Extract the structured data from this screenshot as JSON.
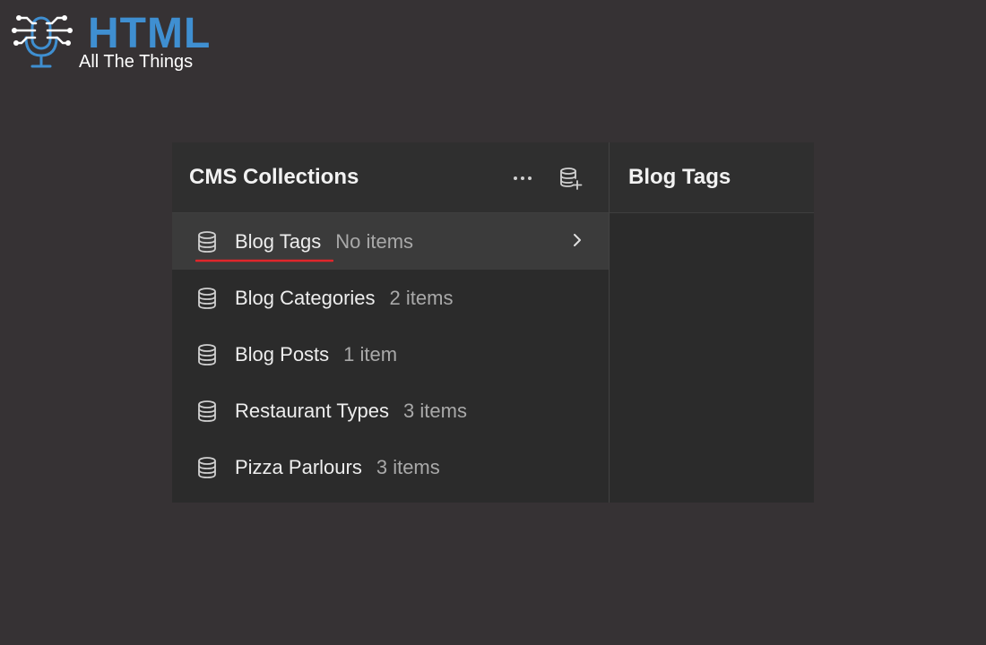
{
  "logo": {
    "brand": "HTML",
    "tagline": "All The Things",
    "brand_color": "#3f8fd1"
  },
  "left_panel": {
    "title": "CMS Collections",
    "more_icon": "more-horizontal-icon",
    "add_icon": "database-add-icon"
  },
  "right_panel": {
    "title": "Blog Tags"
  },
  "collections": [
    {
      "name": "Blog Tags",
      "count": "No items",
      "active": true
    },
    {
      "name": "Blog Categories",
      "count": "2 items",
      "active": false
    },
    {
      "name": "Blog Posts",
      "count": "1 item",
      "active": false
    },
    {
      "name": "Restaurant Types",
      "count": "3 items",
      "active": false
    },
    {
      "name": "Pizza Parlours",
      "count": "3 items",
      "active": false
    }
  ],
  "colors": {
    "background": "#363234",
    "panel": "#2b2b2b",
    "active_row": "#3b3b3b",
    "annotation": "#e0262b"
  }
}
